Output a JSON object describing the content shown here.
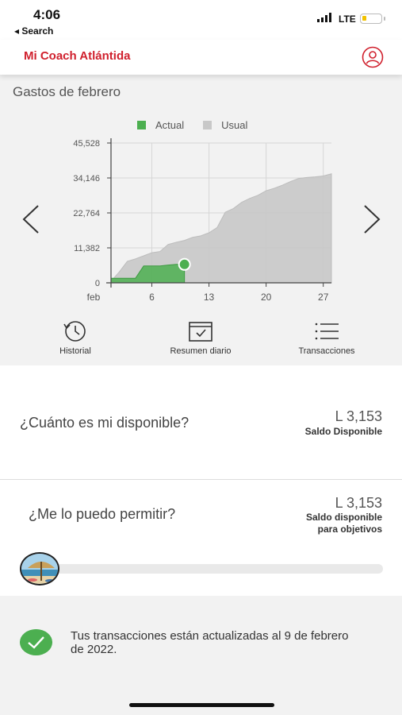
{
  "status_bar": {
    "time": "4:06",
    "back_label": "◂ Search",
    "network": "LTE"
  },
  "header": {
    "title": "Mi Coach Atlántida",
    "profile_icon": "user-circle-icon",
    "accent_color": "#d0202d"
  },
  "chart_section": {
    "title": "Gastos de febrero",
    "prev_icon": "chevron-left-icon",
    "next_icon": "chevron-right-icon",
    "actions": [
      {
        "label": "Historial",
        "icon": "history-clock-icon"
      },
      {
        "label": "Resumen diario",
        "icon": "calendar-check-icon"
      },
      {
        "label": "Transacciones",
        "icon": "list-icon"
      }
    ]
  },
  "chart_data": {
    "type": "area",
    "legend": [
      {
        "name": "Actual",
        "color": "#4caf50"
      },
      {
        "name": "Usual",
        "color": "#c8c8c8"
      }
    ],
    "x_first_label": "feb",
    "x_ticks": [
      {
        "value": 6,
        "label": "6"
      },
      {
        "value": 13,
        "label": "13"
      },
      {
        "value": 20,
        "label": "20"
      },
      {
        "value": 27,
        "label": "27"
      }
    ],
    "y_ticks": [
      {
        "value": 0,
        "label": "0"
      },
      {
        "value": 11382,
        "label": "11,382"
      },
      {
        "value": 22764,
        "label": "22,764"
      },
      {
        "value": 34146,
        "label": "34,146"
      },
      {
        "value": 45528,
        "label": "45,528"
      }
    ],
    "xlim": [
      1,
      28
    ],
    "ylim": [
      0,
      45528
    ],
    "series": [
      {
        "name": "Usual",
        "color": "#c8c8c8",
        "x": [
          1,
          2,
          3,
          4,
          5,
          6,
          7,
          8,
          9,
          10,
          11,
          12,
          13,
          14,
          15,
          16,
          17,
          18,
          19,
          20,
          21,
          22,
          23,
          24,
          25,
          26,
          27,
          28
        ],
        "y": [
          500,
          3500,
          7000,
          7800,
          8800,
          9800,
          10200,
          12500,
          13200,
          13800,
          14800,
          15300,
          16300,
          18000,
          23000,
          24200,
          26200,
          27500,
          28500,
          30000,
          30800,
          31800,
          33000,
          34000,
          34300,
          34500,
          34800,
          35500
        ]
      },
      {
        "name": "Actual",
        "color": "#4caf50",
        "x": [
          1,
          2,
          3,
          4,
          5,
          6,
          7,
          8,
          9,
          10
        ],
        "y": [
          1500,
          1500,
          1500,
          1500,
          5500,
          5500,
          5500,
          5800,
          6000,
          6000
        ]
      }
    ]
  },
  "disponible": {
    "question": "¿Cuánto es mi disponible?",
    "amount": "L  3,153",
    "label": "Saldo Disponible"
  },
  "permitir": {
    "question": "¿Me lo puedo permitir?",
    "amount": "L  3,153",
    "label_line1": "Saldo disponible",
    "label_line2": "para objetivos",
    "progress": 0.0
  },
  "footer": {
    "icon": "check-circle-icon",
    "message": "Tus transacciones están actualizadas al 9 de febrero de 2022."
  }
}
